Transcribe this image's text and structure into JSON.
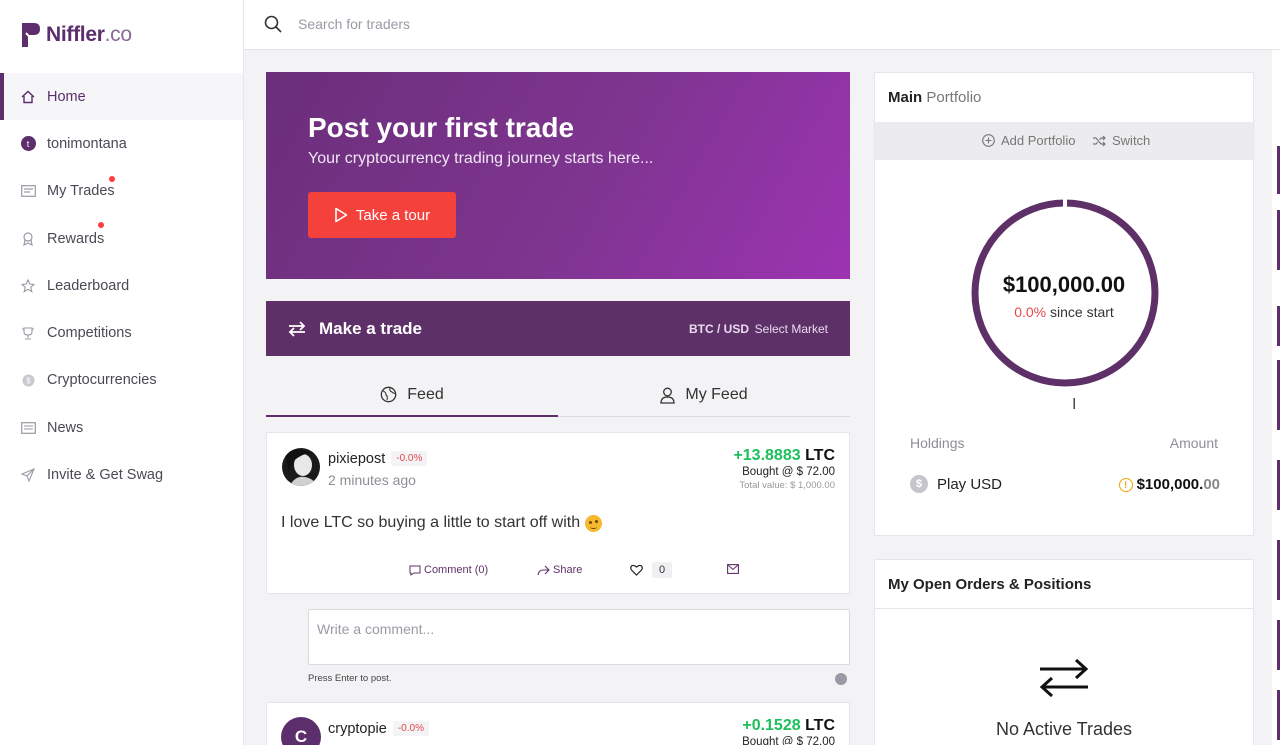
{
  "brand": {
    "name": "Niffler",
    "suffix": ".co"
  },
  "search": {
    "placeholder": "Search for traders"
  },
  "sidebar": {
    "items": [
      {
        "label": "Home",
        "icon": "home-icon",
        "active": true
      },
      {
        "label": "tonimontana",
        "icon": "user-avatar",
        "avatar_letter": "t"
      },
      {
        "label": "My Trades",
        "icon": "trades-icon",
        "notification": true
      },
      {
        "label": "Rewards",
        "icon": "rewards-icon",
        "notification": true
      },
      {
        "label": "Leaderboard",
        "icon": "star-icon"
      },
      {
        "label": "Competitions",
        "icon": "trophy-icon"
      },
      {
        "label": "Cryptocurrencies",
        "icon": "coin-icon"
      },
      {
        "label": "News",
        "icon": "newspaper-icon"
      },
      {
        "label": "Invite & Get Swag",
        "icon": "send-icon"
      }
    ]
  },
  "hero": {
    "title": "Post your first trade",
    "subtitle": "Your cryptocurrency trading journey starts here...",
    "button": "Take a tour"
  },
  "trade_bar": {
    "title": "Make a trade",
    "pair": "BTC / USD",
    "market": "Select Market"
  },
  "tabs": [
    {
      "label": "Feed",
      "icon": "globe-icon",
      "active": true
    },
    {
      "label": "My Feed",
      "icon": "user-icon",
      "active": false
    }
  ],
  "posts": [
    {
      "user": "pixiepost",
      "badge": "-0.0%",
      "time": "2 minutes ago",
      "amount": "+13.8883",
      "coin": "LTC",
      "bought": "Bought @ $ 72.00",
      "total": "Total value: $ 1,000.00",
      "text": "I love LTC so buying a little to start off with",
      "comment_label": "Comment (0)",
      "share_label": "Share",
      "likes": "0"
    },
    {
      "user": "cryptopie",
      "avatar_letter": "C",
      "badge": "-0.0%",
      "amount": "+0.1528",
      "coin": "LTC",
      "bought": "Bought @ $ 72.00"
    }
  ],
  "comment": {
    "placeholder": "Write a comment...",
    "hint": "Press Enter to post."
  },
  "portfolio": {
    "title": "Main",
    "title_sub": "Portfolio",
    "add_label": "Add Portfolio",
    "switch_label": "Switch",
    "value": "$100,000.00",
    "change_pct": "0.0%",
    "change_label": "since start",
    "holdings_label": "Holdings",
    "amount_label": "Amount",
    "holdings": [
      {
        "name": "Play USD",
        "amount_main": "$100,000.",
        "amount_cents": "00"
      }
    ]
  },
  "orders": {
    "title": "My Open Orders & Positions",
    "empty": "No Active Trades"
  },
  "colors": {
    "brand": "#5c2e6b",
    "accent": "#f5413c",
    "gain": "#1cbf5c",
    "loss": "#e14a4a"
  }
}
